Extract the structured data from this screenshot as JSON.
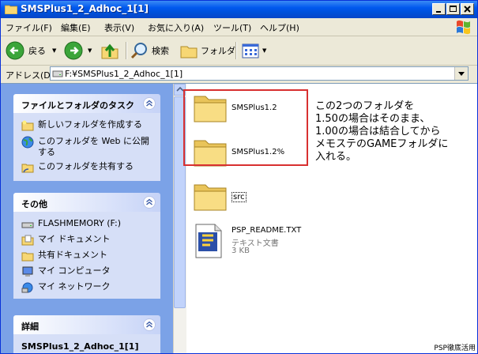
{
  "window": {
    "title": "SMSPlus1_2_Adhoc_1[1]"
  },
  "menu": [
    "ファイル(F)",
    "編集(E)",
    "表示(V)",
    "お気に入り(A)",
    "ツール(T)",
    "ヘルプ(H)"
  ],
  "toolbar": {
    "back": "戻る",
    "search": "検索",
    "folders": "フォルダ"
  },
  "address": {
    "label": "アドレス(D)",
    "value": "F:¥SMSPlus1_2_Adhoc_1[1]"
  },
  "tasks_panel": {
    "title": "ファイルとフォルダのタスク",
    "items": [
      "新しいフォルダを作成する",
      "このフォルダを Web に公開する",
      "このフォルダを共有する"
    ]
  },
  "other_panel": {
    "title": "その他",
    "items": [
      "FLASHMEMORY (F:)",
      "マイ ドキュメント",
      "共有ドキュメント",
      "マイ コンピュータ",
      "マイ ネットワーク"
    ]
  },
  "details_panel": {
    "title": "詳細",
    "name": "SMSPlus1_2_Adhoc_1[1]"
  },
  "files": [
    {
      "name": "SMSPlus1.2",
      "type": "folder"
    },
    {
      "name": "SMSPlus1.2%",
      "type": "folder"
    },
    {
      "name": "src",
      "type": "folder"
    },
    {
      "name": "PSP_README.TXT",
      "type": "text",
      "kind": "テキスト文書",
      "size": "3 KB"
    }
  ],
  "annotation": {
    "lines": [
      "この2つのフォルダを",
      "1.50の場合はそのまま、",
      "1.00の場合は結合してから",
      "メモステのGAMEフォルダに",
      "入れる。"
    ]
  },
  "watermark": "PSP徹底活用"
}
